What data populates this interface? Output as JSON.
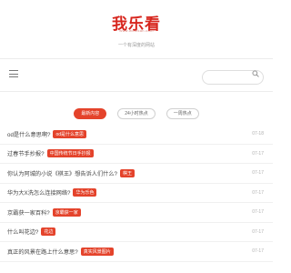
{
  "header": {
    "logo": "我乐看",
    "logo_url": "www.wolekan.com",
    "slogan": "一个有深度的网站"
  },
  "search": {
    "value": "",
    "placeholder": ""
  },
  "icons": {
    "menu": "menu-icon",
    "search": "search-icon"
  },
  "colors": {
    "accent": "#e4432b",
    "brand": "#d7261e"
  },
  "tabs": [
    {
      "label": "最新内容",
      "active": true
    },
    {
      "label": "24小时热点",
      "active": false
    },
    {
      "label": "一周热点",
      "active": false
    }
  ],
  "articles": [
    {
      "title": "od是什么意思啊?",
      "tag": "od是什么意思",
      "date": "07-18"
    },
    {
      "title": "过春节手抄报?",
      "tag": "中国传统节日手抄报",
      "date": "07-17"
    },
    {
      "title": "你认为阿城的小说《棋王》想告诉人们什么?",
      "tag": "棋王",
      "date": "07-17"
    },
    {
      "title": "华为大X洗怎么连接网络?",
      "tag": "华为乐色",
      "date": "07-17"
    },
    {
      "title": "京霸获一家百科?",
      "tag": "京霸获一家",
      "date": "07-17"
    },
    {
      "title": "什么叫花边?",
      "tag": "花边",
      "date": "07-17"
    },
    {
      "title": "真正的风景在路上什么意思?",
      "tag": "真实风景图片",
      "date": "07-17"
    }
  ]
}
